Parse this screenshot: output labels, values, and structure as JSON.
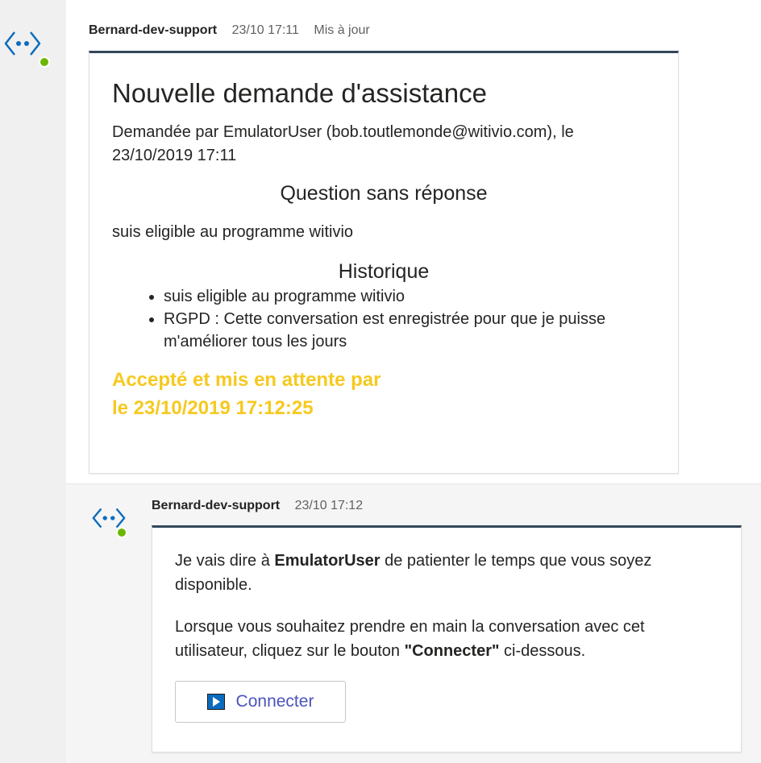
{
  "message1": {
    "sender": "Bernard-dev-support",
    "time": "23/10 17:11",
    "edited": "Mis à jour",
    "card": {
      "title": "Nouvelle demande d'assistance",
      "requested_by": "Demandée par EmulatorUser (bob.toutlemonde@witivio.com), le 23/10/2019 17:11",
      "unanswered_heading": "Question sans réponse",
      "question": "suis eligible au programme witivio",
      "history_heading": "Historique",
      "history": [
        "suis eligible au programme witivio",
        "RGPD : Cette conversation est enregistrée pour que je puisse m'améliorer tous les jours"
      ],
      "accepted_line1": "Accepté et mis en attente par",
      "accepted_line2": "le 23/10/2019 17:12:25",
      "accepted_color": "#f6c91f"
    }
  },
  "message2": {
    "sender": "Bernard-dev-support",
    "time": "23/10 17:12",
    "para1_before": "Je vais dire à ",
    "para1_bold": "EmulatorUser",
    "para1_after": " de patienter le temps que vous soyez disponible.",
    "para2_before": "Lorsque vous souhaitez prendre en main la conversation avec cet utilisateur, cliquez sur le bouton ",
    "para2_bold": "\"Connecter\"",
    "para2_after": " ci-dessous.",
    "button_label": "Connecter",
    "button_icon": "play-icon"
  },
  "colors": {
    "accent_border": "#33475b",
    "bot_icon": "#0b6cbd",
    "presence": "#6bb700",
    "button_text": "#4b53bc"
  }
}
